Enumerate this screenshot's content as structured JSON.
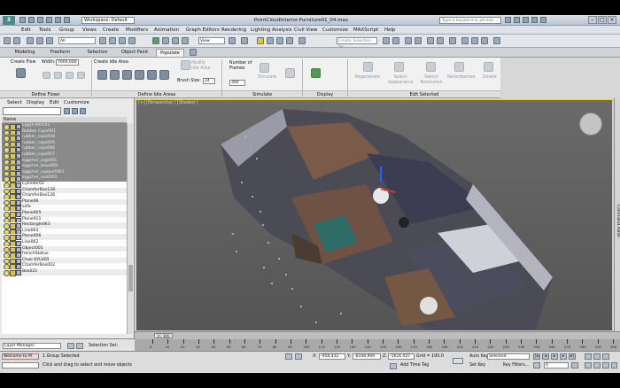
{
  "window": {
    "logo": "3",
    "workspace_label": "Workspace: Default",
    "title": "PointCloudInterior-Furniture01_04.max",
    "search_placeholder": "Type a keyword or phrase"
  },
  "menu": [
    "Edit",
    "Tools",
    "Group",
    "Views",
    "Create",
    "Modifiers",
    "Animation",
    "Graph Editors",
    "Rendering",
    "Lighting Analysis",
    "Civil View",
    "Customize",
    "MAXScript",
    "Help"
  ],
  "toolbar": {
    "filter_value": "All",
    "view_value": "View",
    "selection_set_placeholder": "Create Selection Se"
  },
  "ribbon_tabs": [
    "Modeling",
    "Freeform",
    "Selection",
    "Object Paint",
    "Populate"
  ],
  "ribbon": {
    "create_flow": "Create Flow",
    "width_label": "Width:",
    "width_value": "7000.000",
    "create_idle_area": "Create Idle Area",
    "modify_idle_area": "Modify Idle Area",
    "brush_size_label": "Brush Size:",
    "brush_size_value": "24",
    "number_of_frames_label": "Number of Frames",
    "frames_value": "300",
    "simulate": "Simulate",
    "regenerate": "Regenerate",
    "select_appearance": "Select Appearance",
    "switch_resolution": "Switch Resolution",
    "rerandomize": "Rerandomize",
    "delete": "Delete",
    "groups": [
      "Define Flows",
      "Define Idle Areas",
      "Simulate",
      "Display",
      "Edit Selected"
    ]
  },
  "scene_explorer": {
    "menu": [
      "Select",
      "Display",
      "Edit",
      "Customize"
    ],
    "column_header": "Name",
    "items": [
      {
        "name": "Egg(Flatter01",
        "selected": true
      },
      {
        "name": "Rubber Caps001",
        "selected": true
      },
      {
        "name": "rubber_caps004",
        "selected": true
      },
      {
        "name": "rubber_caps005",
        "selected": true
      },
      {
        "name": "rubber_caps006",
        "selected": true
      },
      {
        "name": "rubber_caps007",
        "selected": true
      },
      {
        "name": "eggcher_legs001",
        "selected": true
      },
      {
        "name": "eggcher_base001",
        "selected": true
      },
      {
        "name": "eggcher_support001",
        "selected": true
      },
      {
        "name": "eggcher_seat001",
        "selected": true
      },
      {
        "name": "Cylinder02",
        "selected": false
      },
      {
        "name": "ChamferBox128",
        "selected": false
      },
      {
        "name": "ChamferBox126",
        "selected": false
      },
      {
        "name": "Plane06",
        "selected": false
      },
      {
        "name": "sofa",
        "selected": false
      },
      {
        "name": "Plane005",
        "selected": false
      },
      {
        "name": "Plane011",
        "selected": false
      },
      {
        "name": "Rectangle063",
        "selected": false
      },
      {
        "name": "Line063",
        "selected": false
      },
      {
        "name": "Plane006",
        "selected": false
      },
      {
        "name": "Line062",
        "selected": false
      },
      {
        "name": "Object001",
        "selected": false
      },
      {
        "name": "frenchStatue",
        "selected": false
      },
      {
        "name": "Chair-SYLVER",
        "selected": false
      },
      {
        "name": "ChamferBox002",
        "selected": false
      },
      {
        "name": "Box021",
        "selected": false
      }
    ],
    "layer_manager": "Layer Manager",
    "selection_set": "Selection Set:"
  },
  "viewport": {
    "label": "[+] [Perspective ] [Shaded ]",
    "side_panel": "Command Panel"
  },
  "timeline": {
    "frame_counter": "0 / 300",
    "ticks": [
      "0",
      "10",
      "20",
      "30",
      "40",
      "50",
      "60",
      "70",
      "80",
      "90",
      "100",
      "110",
      "120",
      "130",
      "140",
      "150",
      "160",
      "170",
      "180",
      "190",
      "200",
      "210",
      "220",
      "230",
      "240",
      "250",
      "260",
      "270",
      "280",
      "290",
      "300"
    ]
  },
  "status": {
    "script_text": "Welcome to M",
    "group_selected": "1 Group Selected",
    "hint": "Click and drag to select and move objects",
    "x_label": "X:",
    "x_value": "-958.332",
    "y_label": "Y:",
    "y_value": "-8348.909",
    "z_label": "Z:",
    "z_value": "-1626.427",
    "grid": "Grid = 100.0",
    "add_time_tag": "Add Time Tag",
    "auto_key": "Auto Key",
    "auto_key_value": "Selected",
    "set_key": "Set Key",
    "key_filters": "Key Filters...",
    "frame_value": "0"
  },
  "colors": {
    "selected_row": "#8a8a8a",
    "viewport_border": "#e8dd2a",
    "viewport_bg": "#5f5f5f"
  }
}
